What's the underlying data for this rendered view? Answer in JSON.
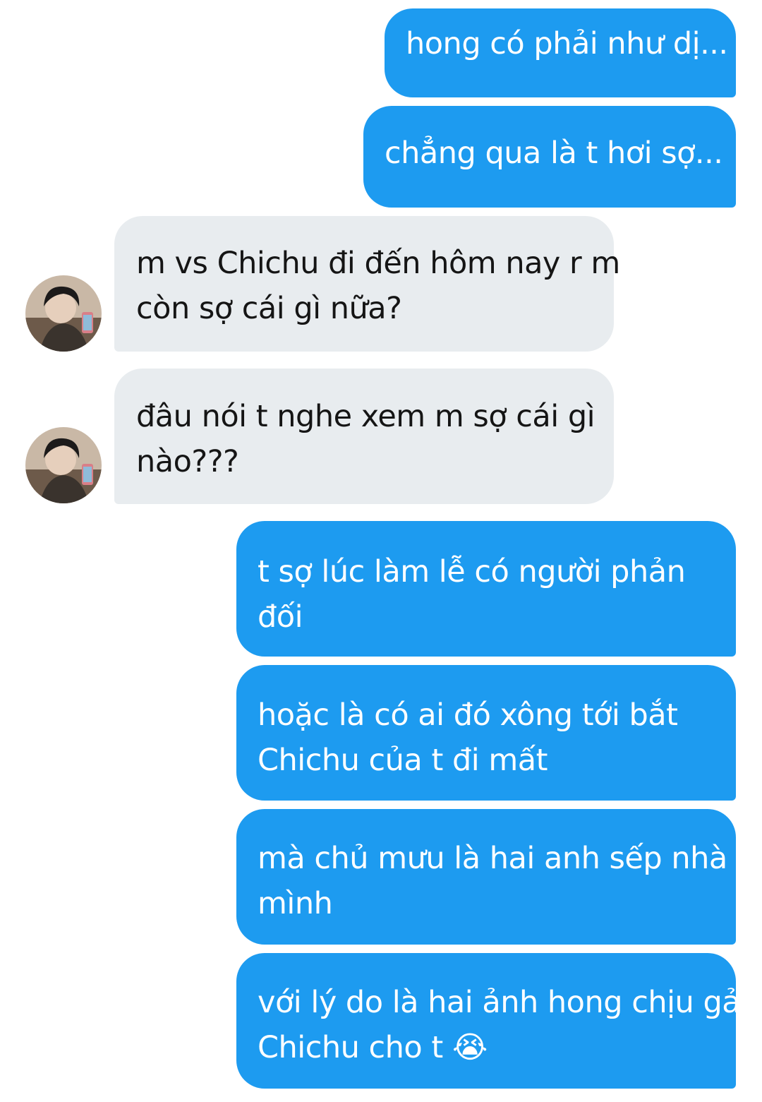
{
  "colors": {
    "outgoing_bubble": "#1d9bf0",
    "incoming_bubble": "#e8ecef",
    "outgoing_text": "#ffffff",
    "incoming_text": "#151515"
  },
  "messages": [
    {
      "sender": "me",
      "lines": [
        "hong có phải như dị..."
      ]
    },
    {
      "sender": "me",
      "lines": [
        "chẳng qua là t hơi sợ..."
      ]
    },
    {
      "sender": "other",
      "avatar": "profile-photo",
      "lines": [
        "m vs Chichu đi đến hôm nay r m",
        "còn sợ cái gì nữa?"
      ]
    },
    {
      "sender": "other",
      "avatar": "profile-photo",
      "lines": [
        "đâu nói t nghe xem m sợ cái gì",
        "nào???"
      ]
    },
    {
      "sender": "me",
      "lines": [
        "t sợ lúc làm lễ có người phản",
        "đối"
      ]
    },
    {
      "sender": "me",
      "lines": [
        "hoặc là có ai đó xông tới bắt",
        "Chichu của t đi mất"
      ]
    },
    {
      "sender": "me",
      "lines": [
        "mà chủ mưu là hai anh sếp nhà",
        "mình"
      ]
    },
    {
      "sender": "me",
      "lines": [
        "với lý do là hai ảnh hong chịu gả",
        "Chichu cho t 😭"
      ]
    }
  ]
}
